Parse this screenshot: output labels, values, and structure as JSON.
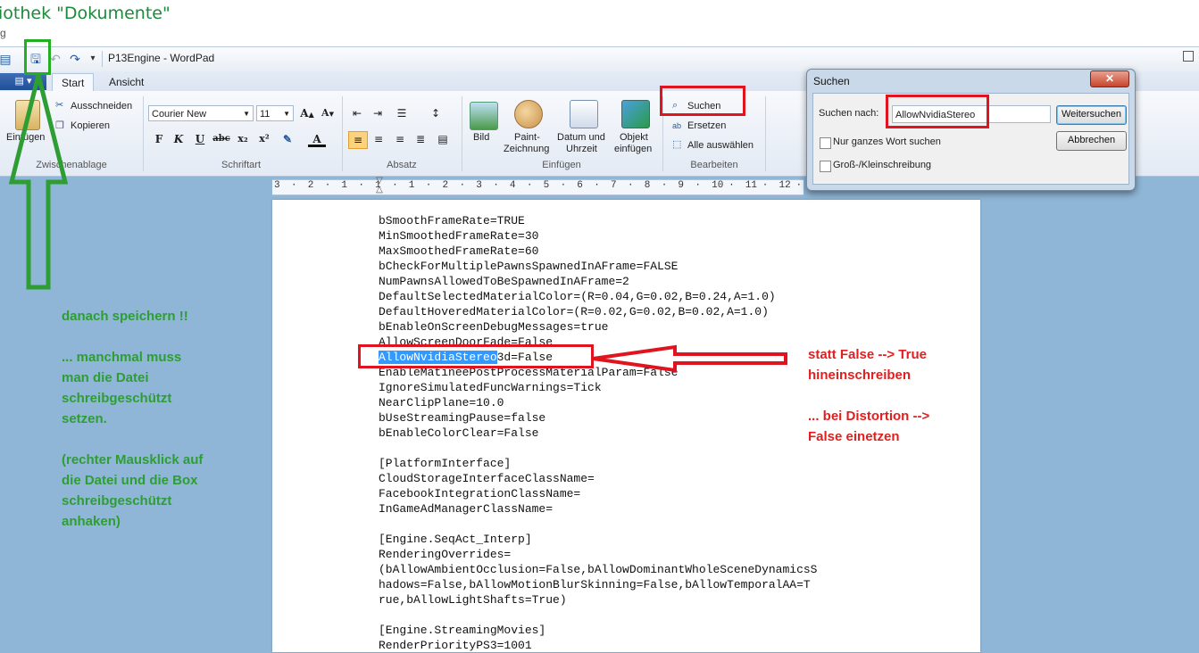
{
  "explorer": {
    "title": "iothek \"Dokumente\"",
    "subtitle": "g"
  },
  "window": {
    "title": "P13Engine - WordPad",
    "filemenu_icon": "file-menu-icon"
  },
  "tabs": [
    {
      "label": "Start"
    },
    {
      "label": "Ansicht"
    }
  ],
  "ribbon": {
    "clipboard": {
      "paste": "Einfügen",
      "cut": "Ausschneiden",
      "copy": "Kopieren",
      "group": "Zwischenablage"
    },
    "font": {
      "family": "Courier New",
      "size": "11",
      "group": "Schriftart"
    },
    "paragraph": {
      "group": "Absatz"
    },
    "insert": {
      "picture": "Bild",
      "paint_line1": "Paint-",
      "paint_line2": "Zeichnung",
      "datetime_line1": "Datum und",
      "datetime_line2": "Uhrzeit",
      "object_line1": "Objekt",
      "object_line2": "einfügen",
      "group": "Einfügen"
    },
    "edit": {
      "find": "Suchen",
      "replace": "Ersetzen",
      "select_all": "Alle auswählen",
      "group": "Bearbeiten"
    }
  },
  "ruler": {
    "numbers": [
      "3",
      "2",
      "1",
      "1",
      "1",
      "2",
      "3",
      "4",
      "5",
      "6",
      "7",
      "8",
      "9",
      "10",
      "11",
      "12"
    ]
  },
  "document": {
    "lines": [
      "bSmoothFrameRate=TRUE",
      "MinSmoothedFrameRate=30",
      "MaxSmoothedFrameRate=60",
      "bCheckForMultiplePawnsSpawnedInAFrame=FALSE",
      "NumPawnsAllowedToBeSpawnedInAFrame=2",
      "DefaultSelectedMaterialColor=(R=0.04,G=0.02,B=0.24,A=1.0)",
      "DefaultHoveredMaterialColor=(R=0.02,G=0.02,B=0.02,A=1.0)",
      "bEnableOnScreenDebugMessages=true",
      "AllowScreenDoorFade=False",
      "",
      "EnableMatineePostProcessMaterialParam=False",
      "IgnoreSimulatedFuncWarnings=Tick",
      "NearClipPlane=10.0",
      "bUseStreamingPause=false",
      "bEnableColorClear=False",
      "",
      "[PlatformInterface]",
      "CloudStorageInterfaceClassName=",
      "FacebookIntegrationClassName=",
      "InGameAdManagerClassName=",
      "",
      "[Engine.SeqAct_Interp]",
      "RenderingOverrides=",
      "(bAllowAmbientOcclusion=False,bAllowDominantWholeSceneDynamicsS",
      "hadows=False,bAllowMotionBlurSkinning=False,bAllowTemporalAA=T",
      "rue,bAllowLightShafts=True)",
      "",
      "[Engine.StreamingMovies]",
      "RenderPriorityPS3=1001"
    ],
    "highlight_selected": "AllowNvidiaStereo",
    "highlight_rest": "3d=False"
  },
  "annotations": {
    "green": [
      "danach speichern !!",
      "",
      "... manchmal muss",
      "man die Datei",
      "schreibgeschützt",
      "setzen.",
      "",
      "(rechter Mausklick auf",
      "die Datei und die Box",
      "schreibgeschützt",
      "anhaken)"
    ],
    "red_1": [
      "statt False --> True",
      "hineinschreiben"
    ],
    "red_2": [
      "... bei Distortion -->",
      "False einetzen"
    ]
  },
  "dialog": {
    "title": "Suchen",
    "close": "✕",
    "search_label": "Suchen nach:",
    "search_value": "AllowNvidiaStereo",
    "find_next": "Weitersuchen",
    "cancel": "Abbrechen",
    "whole_word": "Nur ganzes Wort suchen",
    "match_case": "Groß-/Kleinschreibung"
  },
  "colors": {
    "annotation_green": "#2e9e34",
    "annotation_red": "#e02020",
    "selection": "#3399ff"
  }
}
